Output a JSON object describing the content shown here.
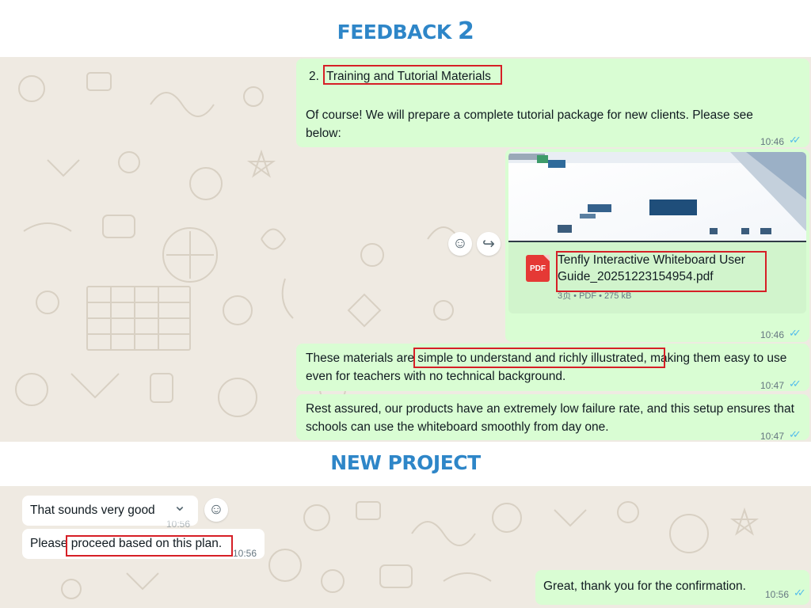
{
  "headings": {
    "feedback_word": "FEEDBACK",
    "feedback_num": "2",
    "new_project": "NEW PROJECT"
  },
  "colors": {
    "heading": "#2e86c8",
    "outgoing_bubble": "#d9fdd3",
    "incoming_bubble": "#ffffff",
    "chat_background": "#efeae2",
    "highlight_box": "#d61f26",
    "read_ticks": "#53bdeb"
  },
  "messages": {
    "m1": {
      "list_number": "2.",
      "list_title": "Training and Tutorial Materials",
      "body": "Of course! We will prepare a complete tutorial package for new clients. Please see below:",
      "time": "10:46"
    },
    "doc": {
      "file_name": "Tenfly Interactive Whiteboard User Guide_20251223154954.pdf",
      "meta": "3页 • PDF • 275 kB",
      "icon_label": "PDF",
      "time": "10:46"
    },
    "m3": {
      "text_before": "These materials are ",
      "text_highlight": "simple to understand and richly illustrated,",
      "text_after": " making them easy to use even for teachers with no technical background.",
      "time": "10:47"
    },
    "m4": {
      "text": "Rest assured, our products have an extremely low failure rate, and this setup ensures that schools can use the whiteboard smoothly from day one.",
      "time": "10:47"
    },
    "in1": {
      "text": "That sounds very good",
      "time": "10:56"
    },
    "in2": {
      "text_before": "Please ",
      "text_highlight": "proceed based on this plan.",
      "time": "10:56"
    },
    "out_last": {
      "text": "Great, thank you for the confirmation.",
      "time": "10:56"
    }
  },
  "icons": {
    "emoji": "☺",
    "forward": "↪",
    "chevron": "⌄",
    "read_ticks": "✓✓"
  }
}
